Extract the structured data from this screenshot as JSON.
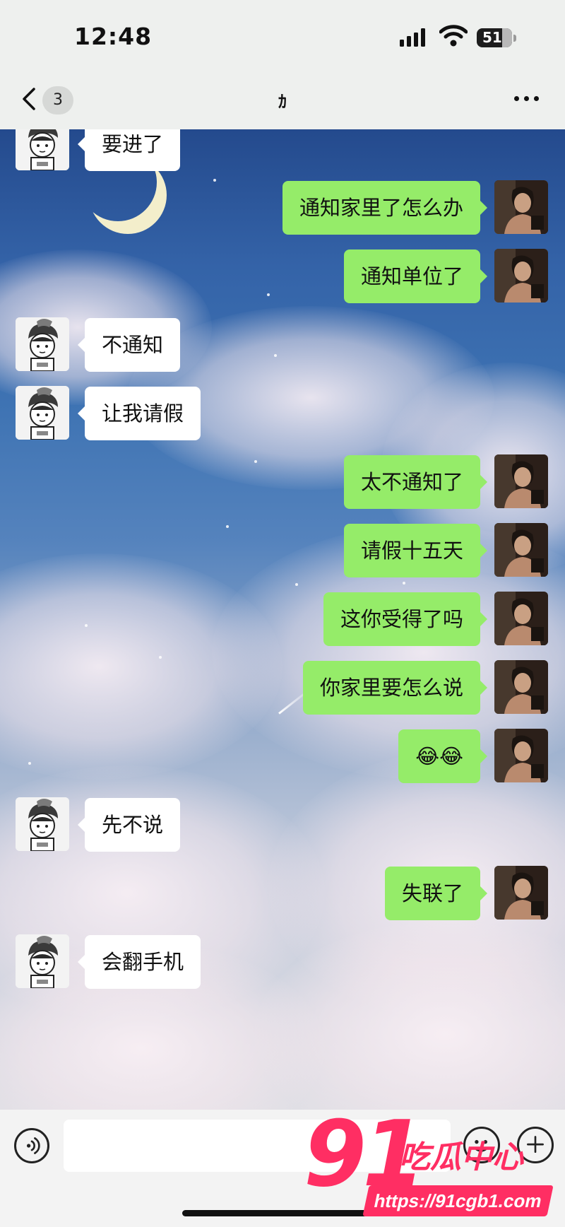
{
  "status_bar": {
    "time": "12:48",
    "battery": "51"
  },
  "header": {
    "unread_badge": "3",
    "title": "ｶ"
  },
  "messages": [
    {
      "side": "left",
      "text": "要进了"
    },
    {
      "side": "right",
      "text": "通知家里了怎么办"
    },
    {
      "side": "right",
      "text": "通知单位了"
    },
    {
      "side": "left",
      "text": "不通知"
    },
    {
      "side": "left",
      "text": "让我请假"
    },
    {
      "side": "right",
      "text": "太不通知了"
    },
    {
      "side": "right",
      "text": "请假十五天"
    },
    {
      "side": "right",
      "text": "这你受得了吗"
    },
    {
      "side": "right",
      "text": "你家里要怎么说"
    },
    {
      "side": "right",
      "text": "😂😂"
    },
    {
      "side": "left",
      "text": "先不说"
    },
    {
      "side": "right",
      "text": "失联了"
    },
    {
      "side": "left",
      "text": "会翻手机"
    }
  ],
  "input": {
    "value": ""
  },
  "watermark": {
    "number": "91",
    "name": "吃瓜中心",
    "url": "https://91cgb1.com"
  },
  "colors": {
    "sent_bubble": "#95ec69",
    "received_bubble": "#ffffff",
    "watermark": "#ff2e63"
  }
}
